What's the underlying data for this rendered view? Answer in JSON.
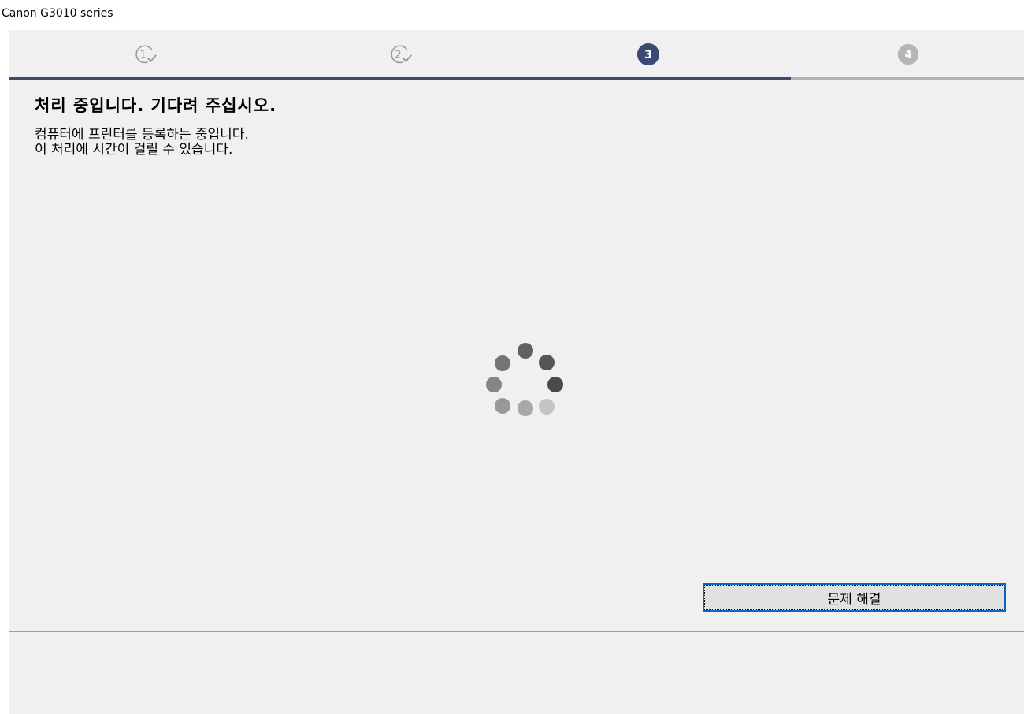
{
  "window": {
    "title": "Canon G3010 series"
  },
  "steps": [
    {
      "number": "1",
      "state": "completed",
      "icon": "check-circle-1-icon"
    },
    {
      "number": "2",
      "state": "completed",
      "icon": "check-circle-2-icon"
    },
    {
      "number": "3",
      "state": "current",
      "icon": "filled-circle-3-icon"
    },
    {
      "number": "4",
      "state": "pending",
      "icon": "filled-circle-4-icon"
    }
  ],
  "progress": {
    "fraction": 0.77
  },
  "main": {
    "heading": "처리 중입니다. 기다려 주십시오.",
    "description_line1": "컴퓨터에 프린터를 등록하는 중입니다.",
    "description_line2": "이 처리에 시간이 걸릴 수 있습니다."
  },
  "spinner": {
    "icon": "loading-spinner-icon"
  },
  "footer": {
    "troubleshoot_label": "문제 해결"
  },
  "colors": {
    "accent": "#3c4a73",
    "progress_fill": "#404a6e",
    "progress_track": "#b3b3b3",
    "pending_step": "#b5b5b5",
    "button_focus": "#0b66c2",
    "background": "#f0f0f0"
  }
}
